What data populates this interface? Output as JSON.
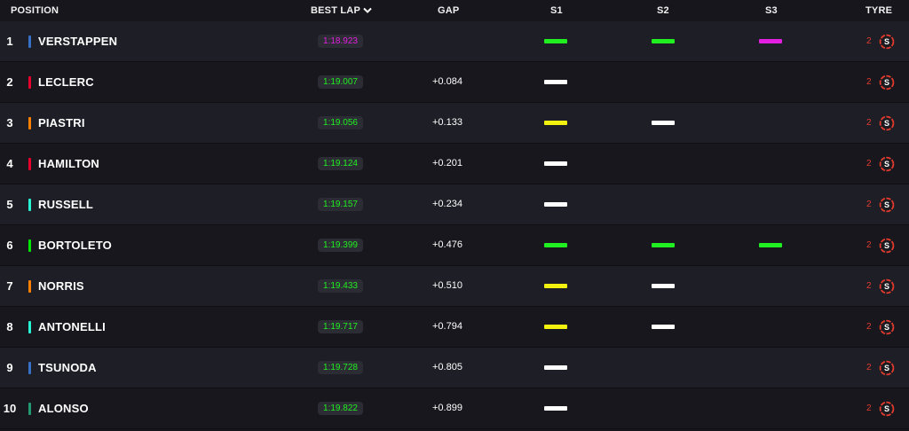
{
  "header": {
    "position": "POSITION",
    "best_lap": "BEST LAP",
    "gap": "GAP",
    "s1": "S1",
    "s2": "S2",
    "s3": "S3",
    "tyre": "TYRE"
  },
  "colors": {
    "purple": "#e21fe0",
    "green": "#20f020",
    "yellow": "#f2f20e",
    "white": "#ffffff",
    "tyre_soft": "#e23b2e"
  },
  "rows": [
    {
      "pos": "1",
      "driver": "VERSTAPPEN",
      "team_color": "#3671c6",
      "best_lap": "1:18.923",
      "lap_color": "#e21fe0",
      "gap": "",
      "s1": "#20f020",
      "s2": "#20f020",
      "s3": "#e21fe0",
      "tyre_laps": "2",
      "tyre_compound": "S",
      "tyre_icon": "soft-tyre-icon"
    },
    {
      "pos": "2",
      "driver": "LECLERC",
      "team_color": "#e8002d",
      "best_lap": "1:19.007",
      "lap_color": "#20f020",
      "gap": "+0.084",
      "s1": "#ffffff",
      "s2": "",
      "s3": "",
      "tyre_laps": "2",
      "tyre_compound": "S",
      "tyre_icon": "soft-tyre-icon"
    },
    {
      "pos": "3",
      "driver": "PIASTRI",
      "team_color": "#ff8000",
      "best_lap": "1:19.056",
      "lap_color": "#20f020",
      "gap": "+0.133",
      "s1": "#f2f20e",
      "s2": "#ffffff",
      "s3": "",
      "tyre_laps": "2",
      "tyre_compound": "S",
      "tyre_icon": "soft-tyre-icon"
    },
    {
      "pos": "4",
      "driver": "HAMILTON",
      "team_color": "#e8002d",
      "best_lap": "1:19.124",
      "lap_color": "#20f020",
      "gap": "+0.201",
      "s1": "#ffffff",
      "s2": "",
      "s3": "",
      "tyre_laps": "2",
      "tyre_compound": "S",
      "tyre_icon": "soft-tyre-icon"
    },
    {
      "pos": "5",
      "driver": "RUSSELL",
      "team_color": "#27f4d2",
      "best_lap": "1:19.157",
      "lap_color": "#20f020",
      "gap": "+0.234",
      "s1": "#ffffff",
      "s2": "",
      "s3": "",
      "tyre_laps": "2",
      "tyre_compound": "S",
      "tyre_icon": "soft-tyre-icon"
    },
    {
      "pos": "6",
      "driver": "BORTOLETO",
      "team_color": "#00e701",
      "best_lap": "1:19.399",
      "lap_color": "#20f020",
      "gap": "+0.476",
      "s1": "#20f020",
      "s2": "#20f020",
      "s3": "#20f020",
      "tyre_laps": "2",
      "tyre_compound": "S",
      "tyre_icon": "soft-tyre-icon"
    },
    {
      "pos": "7",
      "driver": "NORRIS",
      "team_color": "#ff8000",
      "best_lap": "1:19.433",
      "lap_color": "#20f020",
      "gap": "+0.510",
      "s1": "#f2f20e",
      "s2": "#ffffff",
      "s3": "",
      "tyre_laps": "2",
      "tyre_compound": "S",
      "tyre_icon": "soft-tyre-icon"
    },
    {
      "pos": "8",
      "driver": "ANTONELLI",
      "team_color": "#27f4d2",
      "best_lap": "1:19.717",
      "lap_color": "#20f020",
      "gap": "+0.794",
      "s1": "#f2f20e",
      "s2": "#ffffff",
      "s3": "",
      "tyre_laps": "2",
      "tyre_compound": "S",
      "tyre_icon": "soft-tyre-icon"
    },
    {
      "pos": "9",
      "driver": "TSUNODA",
      "team_color": "#3671c6",
      "best_lap": "1:19.728",
      "lap_color": "#20f020",
      "gap": "+0.805",
      "s1": "#ffffff",
      "s2": "",
      "s3": "",
      "tyre_laps": "2",
      "tyre_compound": "S",
      "tyre_icon": "soft-tyre-icon"
    },
    {
      "pos": "10",
      "driver": "ALONSO",
      "team_color": "#229971",
      "best_lap": "1:19.822",
      "lap_color": "#20f020",
      "gap": "+0.899",
      "s1": "#ffffff",
      "s2": "",
      "s3": "",
      "tyre_laps": "2",
      "tyre_compound": "S",
      "tyre_icon": "soft-tyre-icon"
    }
  ]
}
